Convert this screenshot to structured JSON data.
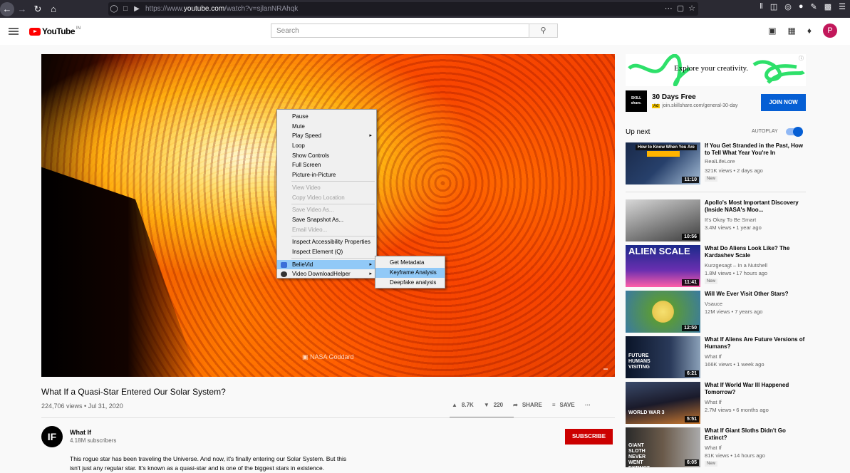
{
  "browser": {
    "url_prefix": "https://www.",
    "url_host": "youtube.com",
    "url_path": "/watch?v=sjlanNRAhqk"
  },
  "header": {
    "logo_text": "YouTube",
    "logo_region": "IN",
    "search_placeholder": "Search",
    "avatar_letter": "P"
  },
  "video": {
    "credit": "NASA Goddard",
    "title": "What If a Quasi-Star Entered Our Solar System?",
    "meta": "224,706 views • Jul 31, 2020",
    "likes": "8.7K",
    "dislikes": "220",
    "share": "SHARE",
    "save": "SAVE"
  },
  "context_menu": {
    "items": [
      "Pause",
      "Mute",
      "Play Speed",
      "Loop",
      "Show Controls",
      "Full Screen",
      "Picture-in-Picture",
      "View Video",
      "Copy Video Location",
      "Save Video As...",
      "Save Snapshot As...",
      "Email Video...",
      "Inspect Accessibility Properties",
      "Inspect Element (Q)",
      "BelieVid",
      "Video DownloadHelper"
    ],
    "submenu": [
      "Get Metadata",
      "Keyframe Analysis",
      "Deepfake analysis"
    ]
  },
  "channel": {
    "name": "What If",
    "subs": "4.18M subscribers",
    "subscribe": "SUBSCRIBE",
    "avatar": "IF",
    "description": "This rogue star has been traveling the Universe. And now, it's finally entering our Solar System. But this isn't just any regular star. It's known as a quasi-star and is one of the biggest stars in existence."
  },
  "ad": {
    "tagline": "Explore your creativity.",
    "logo": "SKILL share.",
    "title": "30 Days Free",
    "badge": "Ad",
    "url": "join.skillshare.com/general-30-day",
    "join": "JOIN NOW"
  },
  "sidebar": {
    "up_next": "Up next",
    "autoplay": "AUTOPLAY",
    "recs": [
      {
        "title": "If You Get Stranded in the Past, How to Tell What Year You're In",
        "channel": "RealLifeLore",
        "meta": "321K views • 2 days ago",
        "new": "New",
        "dur": "11:10",
        "thumb_text": "How to Know When You Are"
      },
      {
        "title": "Apollo's Most Important Discovery (Inside NASA's Moo...",
        "channel": "It's Okay To Be Smart",
        "meta": "3.4M views • 1 year ago",
        "dur": "10:56"
      },
      {
        "title": "What Do Aliens Look Like? The Kardashev Scale",
        "channel": "Kurzgesagt – In a Nutshell",
        "meta": "1.8M views • 17 hours ago",
        "new": "New",
        "dur": "11:41",
        "thumb_text": "ALIEN SCALE"
      },
      {
        "title": "Will We Ever Visit Other Stars?",
        "channel": "Vsauce",
        "meta": "12M views • 7 years ago",
        "dur": "12:50"
      },
      {
        "title": "What If Aliens Are Future Versions of Humans?",
        "channel": "What If",
        "meta": "166K views • 1 week ago",
        "dur": "6:21",
        "thumb_text": "FUTURE HUMANS VISITING"
      },
      {
        "title": "What If World War III Happened Tomorrow?",
        "channel": "What If",
        "meta": "2.7M views • 6 months ago",
        "dur": "5:51",
        "thumb_text": "WORLD WAR 3"
      },
      {
        "title": "What If Giant Sloths Didn't Go Extinct?",
        "channel": "What If",
        "meta": "81K views • 14 hours ago",
        "new": "New",
        "dur": "6:05",
        "thumb_text": "GIANT SLOTH NEVER WENT EXTINCT"
      }
    ]
  }
}
